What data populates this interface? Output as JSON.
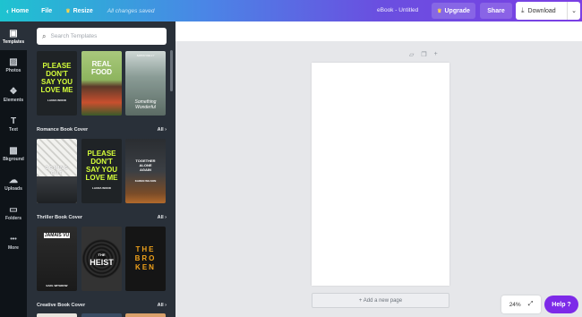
{
  "topbar": {
    "home_label": "Home",
    "file_label": "File",
    "resize_label": "Resize",
    "save_status": "All changes saved",
    "doc_title": "eBook - Untitled",
    "upgrade_label": "Upgrade",
    "share_label": "Share",
    "download_label": "Download"
  },
  "sidebar": {
    "items": [
      {
        "label": "Templates",
        "icon": "templates-icon",
        "glyph": "▣"
      },
      {
        "label": "Photos",
        "icon": "photos-icon",
        "glyph": "▨"
      },
      {
        "label": "Elements",
        "icon": "elements-icon",
        "glyph": "❖"
      },
      {
        "label": "Text",
        "icon": "text-icon",
        "glyph": "T"
      },
      {
        "label": "Bkground",
        "icon": "background-icon",
        "glyph": "▩"
      },
      {
        "label": "Uploads",
        "icon": "uploads-icon",
        "glyph": "☁"
      },
      {
        "label": "Folders",
        "icon": "folders-icon",
        "glyph": "▭"
      },
      {
        "label": "More",
        "icon": "more-icon",
        "glyph": "•••"
      }
    ]
  },
  "panel": {
    "search_placeholder": "Search Templates",
    "all_label": "All",
    "categories": [
      {
        "title": "Romance Book Cover"
      },
      {
        "title": "Thriller Book Cover"
      },
      {
        "title": "Creative Book Cover"
      }
    ],
    "row0": [
      {
        "line1": "PLEASE",
        "line2": "DON'T",
        "line3": "SAY YOU",
        "line4": "LOVE ME",
        "author": "LAURA WOOD"
      },
      {
        "line1": "REAL",
        "line2": "FOOD",
        "line3": "",
        "line4": "",
        "author": ""
      },
      {
        "line1": "Something",
        "line2": "Wonderful",
        "line3": "",
        "line4": "",
        "author": "SIMON KELLY"
      }
    ],
    "row1": [
      {
        "line1": "COMING",
        "line2": "OUT",
        "line3": "",
        "line4": "",
        "author": ""
      },
      {
        "line1": "PLEASE",
        "line2": "DON'T",
        "line3": "SAY YOU",
        "line4": "LOVE ME",
        "author": "LAURA WOOD"
      },
      {
        "line1": "TOGETHER",
        "line2": "ALONE",
        "line3": "AGAIN",
        "line4": "",
        "author": "KAREN WILSON"
      }
    ],
    "row2": [
      {
        "line1": "JAMAIS VU",
        "line2": "",
        "line3": "",
        "line4": "",
        "author": "EARL WITHROW"
      },
      {
        "line1": "THE",
        "line2": "HEIST",
        "line3": "",
        "line4": "",
        "author": ""
      },
      {
        "line1": "THE",
        "line2": "BRO",
        "line3": "KEN",
        "line4": "",
        "author": ""
      }
    ]
  },
  "canvas": {
    "add_page_label": "+ Add a new page",
    "zoom_label": "24%",
    "help_label": "Help ?"
  }
}
